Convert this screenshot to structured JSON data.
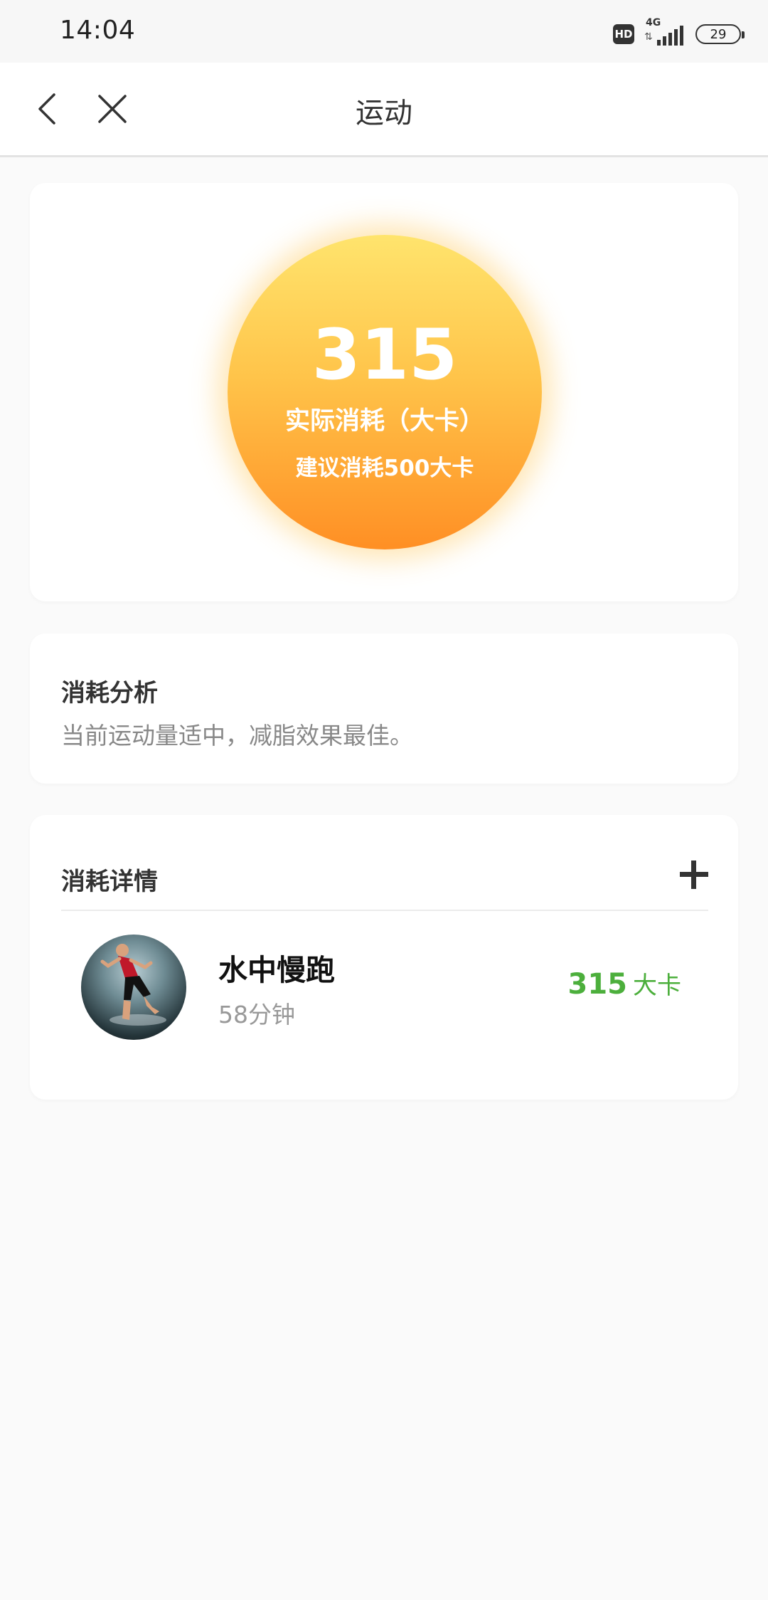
{
  "status_bar": {
    "time": "14:04",
    "hd_label": "HD",
    "network_label": "4G",
    "battery": "29"
  },
  "nav": {
    "title": "运动",
    "back_icon": "chevron-left-icon",
    "close_icon": "close-icon"
  },
  "summary": {
    "calories": "315",
    "calories_label": "实际消耗（大卡）",
    "suggestion": "建议消耗500大卡"
  },
  "analysis": {
    "title": "消耗分析",
    "text": "当前运动量适中，减脂效果最佳。"
  },
  "details": {
    "title": "消耗详情",
    "add_icon": "plus-icon",
    "items": [
      {
        "name": "水中慢跑",
        "duration": "58分钟",
        "calories": "315",
        "unit": "大卡"
      }
    ]
  },
  "colors": {
    "accent_green": "#4caf3c",
    "circle_top": "#ffe46d",
    "circle_bottom": "#ff8f24"
  }
}
